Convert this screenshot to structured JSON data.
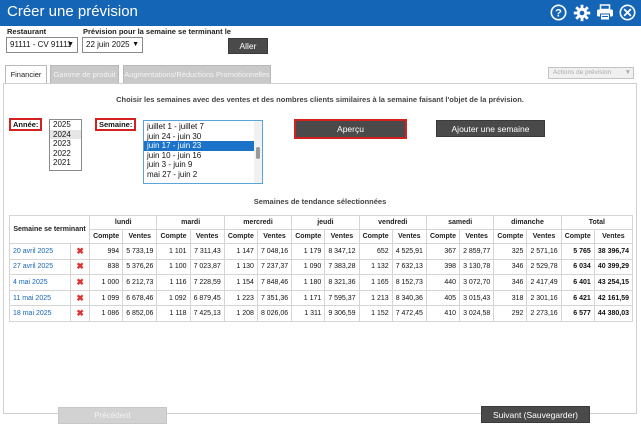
{
  "app": {
    "title": "Créer une prévision"
  },
  "titlebar": {
    "icons": [
      "help-icon",
      "gear-icon",
      "print-icon",
      "close-icon"
    ]
  },
  "filters": {
    "restaurant_label": "Restaurant",
    "restaurant_value": "91111 - CV 91111",
    "week_label": "Prévision pour la semaine se terminant le",
    "week_value": "22 juin 2025",
    "go_label": "Aller"
  },
  "tabs": [
    {
      "label": "Financier",
      "active": true
    },
    {
      "label": "Gamme de produit",
      "active": false
    },
    {
      "label": "Augmentations/Réductions Promotionnelles",
      "active": false
    }
  ],
  "tab_select": {
    "value": "Actions de prévision"
  },
  "panel": {
    "instruction": "Choisir les semaines avec des ventes et des nombres clients similaires à la semaine faisant l'objet de la prévision.",
    "year_label": "Année:",
    "years": [
      "2025",
      "2024",
      "2023",
      "2022",
      "2021"
    ],
    "year_selected": "2024",
    "week_label": "Semaine:",
    "weeks": [
      "juillet 1 - juillet 7",
      "juin 24 - juin 30",
      "juin 17 - juin 23",
      "juin 10 - juin 16",
      "juin 3 - juin 9",
      "mai 27 - juin 2"
    ],
    "week_selected": "juin 17 - juin 23",
    "preview_label": "Aperçu",
    "add_week_label": "Ajouter une semaine",
    "section_title": "Semaines de tendance sélectionnées"
  },
  "table": {
    "week_header": "Semaine se terminant",
    "days": [
      "lundi",
      "mardi",
      "mercredi",
      "jeudi",
      "vendredi",
      "samedi",
      "dimanche",
      "Total"
    ],
    "sub_count": "Compte",
    "sub_sales": "Ventes",
    "rows": [
      {
        "date": "20 avril 2025",
        "del": "✖",
        "cells": [
          "994",
          "5 733,19",
          "1 101",
          "7 311,43",
          "1 147",
          "7 048,16",
          "1 179",
          "8 347,12",
          "652",
          "4 525,91",
          "367",
          "2 859,77",
          "325",
          "2 571,16",
          "5 765",
          "38 396,74"
        ]
      },
      {
        "date": "27 avril 2025",
        "del": "✖",
        "cells": [
          "838",
          "5 376,26",
          "1 100",
          "7 023,87",
          "1 130",
          "7 237,37",
          "1 090",
          "7 383,28",
          "1 132",
          "7 632,13",
          "398",
          "3 130,78",
          "346",
          "2 529,78",
          "6 034",
          "40 399,29"
        ]
      },
      {
        "date": "4 mai 2025",
        "del": "✖",
        "cells": [
          "1 000",
          "6 212,73",
          "1 116",
          "7 228,59",
          "1 154",
          "7 848,46",
          "1 180",
          "8 321,36",
          "1 165",
          "8 152,73",
          "440",
          "3 072,70",
          "346",
          "2 417,49",
          "6 401",
          "43 254,15"
        ]
      },
      {
        "date": "11 mai 2025",
        "del": "✖",
        "cells": [
          "1 099",
          "6 678,46",
          "1 092",
          "6 879,45",
          "1 223",
          "7 351,36",
          "1 171",
          "7 595,37",
          "1 213",
          "8 340,36",
          "405",
          "3 015,43",
          "318",
          "2 301,16",
          "6 421",
          "42 161,59"
        ]
      },
      {
        "date": "18 mai 2025",
        "del": "✖",
        "cells": [
          "1 086",
          "6 852,06",
          "1 118",
          "7 425,13",
          "1 208",
          "8 026,06",
          "1 311",
          "9 306,59",
          "1 152",
          "7 472,45",
          "410",
          "3 024,58",
          "292",
          "2 273,16",
          "6 577",
          "44 380,03"
        ]
      }
    ]
  },
  "footer": {
    "prev_label": "Précédent",
    "next_label": "Suivant (Sauvegarder)"
  }
}
